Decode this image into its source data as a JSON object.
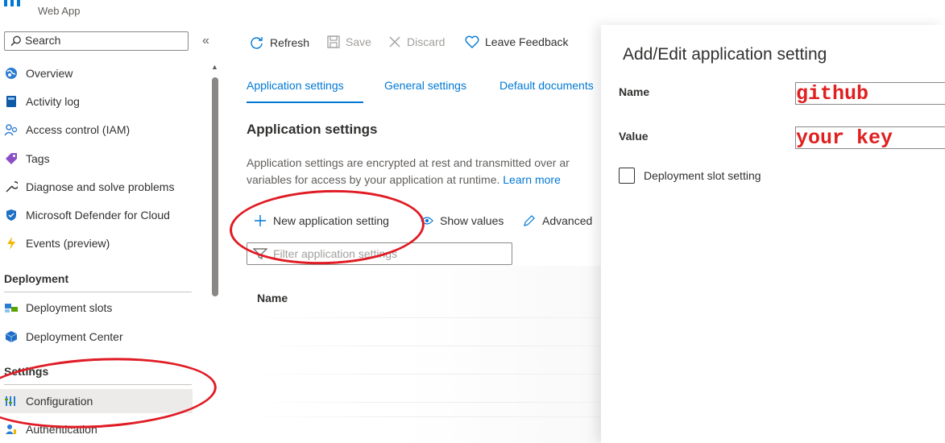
{
  "header": {
    "subtitle": "Web App"
  },
  "sidebar": {
    "search_placeholder": "Search",
    "collapse_glyph": "«",
    "items": [
      {
        "label": "Overview",
        "icon": "globe-icon"
      },
      {
        "label": "Activity log",
        "icon": "activity-log-icon"
      },
      {
        "label": "Access control (IAM)",
        "icon": "people-icon"
      },
      {
        "label": "Tags",
        "icon": "tag-icon"
      },
      {
        "label": "Diagnose and solve problems",
        "icon": "wrench-icon"
      },
      {
        "label": "Microsoft Defender for Cloud",
        "icon": "shield-icon"
      },
      {
        "label": "Events (preview)",
        "icon": "lightning-icon"
      }
    ],
    "deployment_header": "Deployment",
    "deployment_items": [
      {
        "label": "Deployment slots",
        "icon": "slots-icon"
      },
      {
        "label": "Deployment Center",
        "icon": "cube-icon"
      }
    ],
    "settings_header": "Settings",
    "settings_items": [
      {
        "label": "Configuration",
        "icon": "config-bars-icon",
        "active": true
      },
      {
        "label": "Authentication",
        "icon": "person-key-icon"
      }
    ]
  },
  "toolbar": {
    "refresh": "Refresh",
    "save": "Save",
    "discard": "Discard",
    "feedback": "Leave Feedback"
  },
  "tabs": [
    {
      "label": "Application settings",
      "active": true
    },
    {
      "label": "General settings"
    },
    {
      "label": "Default documents"
    }
  ],
  "main": {
    "section_title": "Application settings",
    "description_line1": "Application settings are encrypted at rest and transmitted over ar",
    "description_line2": "variables for access by your application at runtime.",
    "learn_more": "Learn more",
    "new_setting": "New application setting",
    "show_values": "Show values",
    "advanced": "Advanced",
    "filter_placeholder": "Filter application settings",
    "column_name": "Name"
  },
  "panel": {
    "title": "Add/Edit application setting",
    "name_label": "Name",
    "name_value": "github",
    "value_label": "Value",
    "value_value": "your key",
    "slot_setting_label": "Deployment slot setting",
    "slot_setting_checked": false
  },
  "colors": {
    "accent": "#0078d4",
    "annotation": "#e01b24"
  }
}
